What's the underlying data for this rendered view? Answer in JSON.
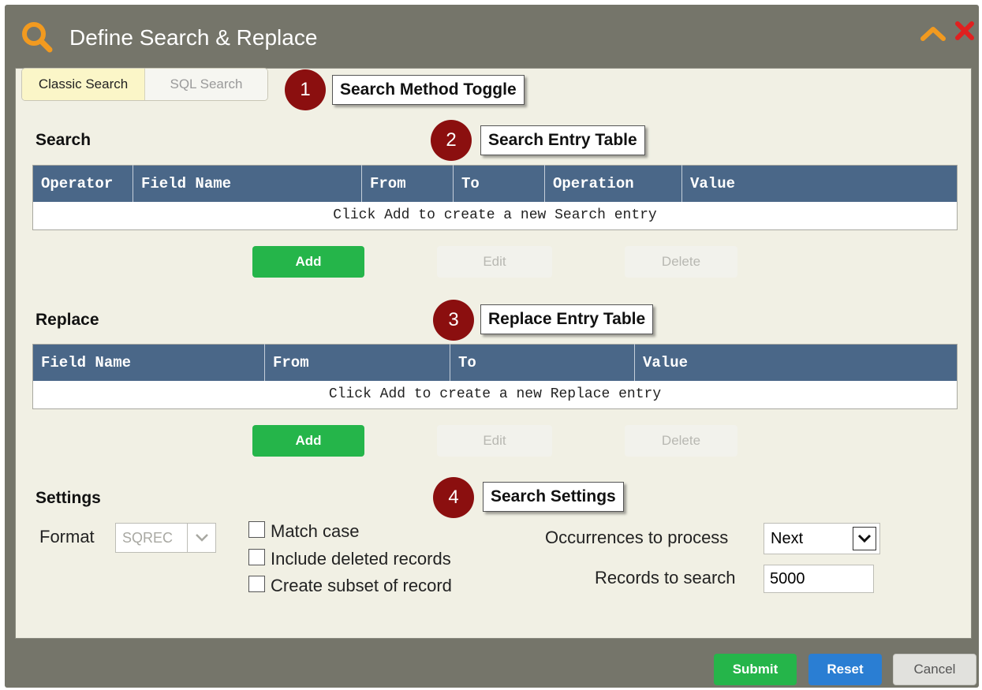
{
  "window": {
    "title": "Define Search & Replace"
  },
  "toggle": {
    "classic_label": "Classic Search",
    "sql_label": "SQL Search",
    "selected": "Classic Search"
  },
  "callouts": [
    {
      "number": "1",
      "label": "Search Method Toggle"
    },
    {
      "number": "2",
      "label": "Search Entry Table"
    },
    {
      "number": "3",
      "label": "Replace Entry Table"
    },
    {
      "number": "4",
      "label": "Search Settings"
    }
  ],
  "search": {
    "label": "Search",
    "columns": [
      "Operator",
      "Field Name",
      "From",
      "To",
      "Operation",
      "Value"
    ],
    "empty_text": "Click Add to create a new Search entry",
    "buttons": {
      "add": "Add",
      "edit": "Edit",
      "delete": "Delete"
    }
  },
  "replace": {
    "label": "Replace",
    "columns": [
      "Field Name",
      "From",
      "To",
      "Value"
    ],
    "empty_text": "Click Add to create a new Replace entry",
    "buttons": {
      "add": "Add",
      "edit": "Edit",
      "delete": "Delete"
    }
  },
  "settings": {
    "label": "Settings",
    "format_label": "Format",
    "format_value": "SQREC",
    "checkboxes": [
      {
        "label": "Match case",
        "checked": false
      },
      {
        "label": "Include deleted records",
        "checked": false
      },
      {
        "label": "Create subset of record",
        "checked": false
      }
    ],
    "occurrences_label": "Occurrences to process",
    "occurrences_value": "Next",
    "records_label": "Records to search",
    "records_value": "5000"
  },
  "footer": {
    "submit": "Submit",
    "reset": "Reset",
    "cancel": "Cancel"
  },
  "colors": {
    "frame": "#75756a",
    "panel": "#f1f0e4",
    "table_header": "#4a6788",
    "add_button": "#25b54a",
    "reset_button": "#2a7ed3",
    "marker": "#8b0f0f",
    "title_icon": "#f29a1f",
    "close_icon": "#e02020"
  }
}
